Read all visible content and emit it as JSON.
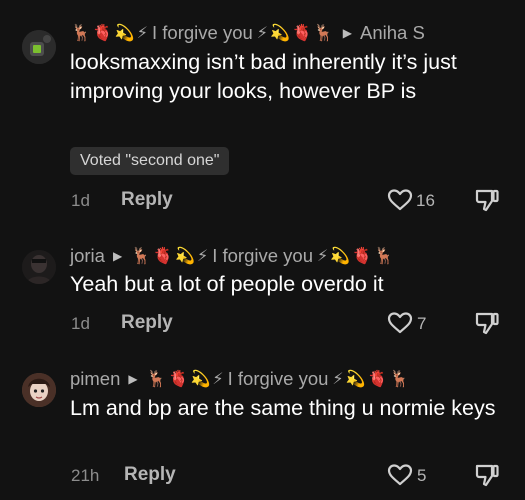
{
  "comments": [
    {
      "author": "Aniha S",
      "badge_text": "I forgive you",
      "body": "looksmaxxing isn’t bad inherently it’s just improving your looks, however BP is",
      "vote": "Voted \"second one\"",
      "time": "1d",
      "reply_label": "Reply",
      "likes": "16"
    },
    {
      "author": "joria",
      "badge_text": "I forgive you",
      "body": "Yeah but a lot of people overdo it",
      "time": "1d",
      "reply_label": "Reply",
      "likes": "7"
    },
    {
      "author": "pimen",
      "badge_text": "I forgive you",
      "body": "Lm and bp are the same thing u normie keys",
      "time": "21h",
      "reply_label": "Reply",
      "likes": "5"
    }
  ],
  "icons": {
    "deer": "deer-icon",
    "heart": "anatomical-heart-icon",
    "dizzy": "dizzy-star-icon",
    "bolt": "lightning-icon",
    "like": "heart-outline-icon",
    "dislike": "thumbs-down-icon",
    "arrow": "play-arrow-icon"
  },
  "colors": {
    "background": "#121212",
    "text": "#ffffff",
    "muted": "#a9a9a9",
    "vote_bg": "#2f2f2f"
  }
}
